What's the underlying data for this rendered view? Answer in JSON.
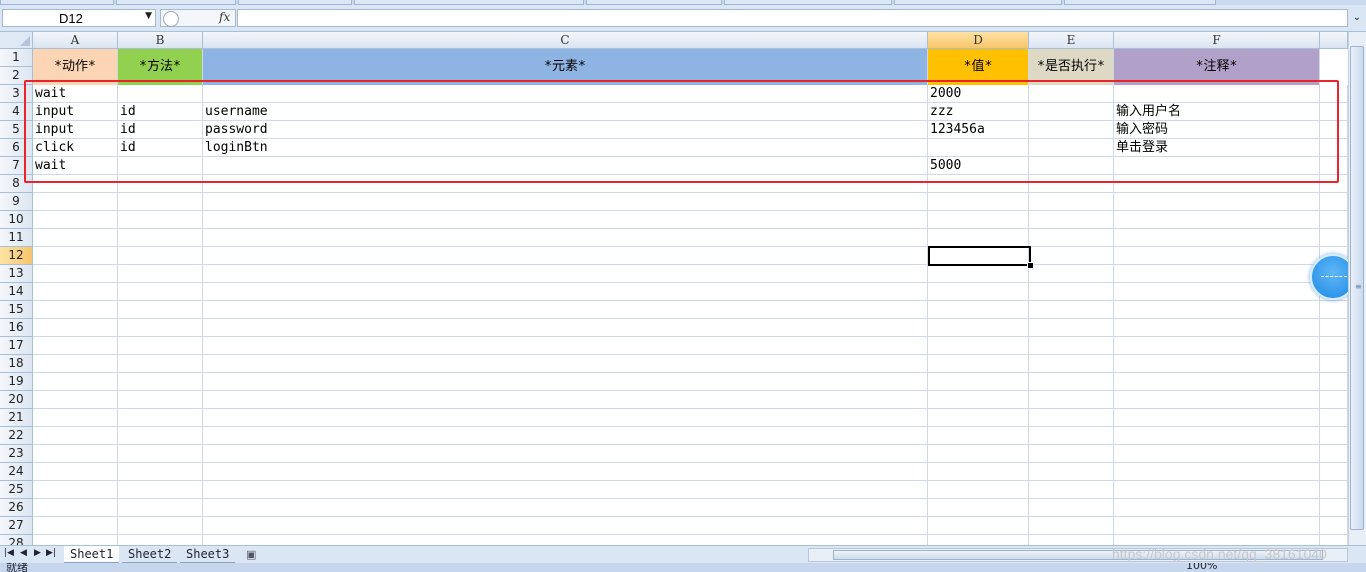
{
  "name_box": {
    "value": "D12"
  },
  "formula_bar": {
    "fx_label": "fx",
    "content": ""
  },
  "columns": [
    "A",
    "B",
    "C",
    "D",
    "E",
    "F"
  ],
  "active_column": "D",
  "rows": [
    "1",
    "2",
    "3",
    "4",
    "5",
    "6",
    "7",
    "8",
    "9",
    "10",
    "11",
    "12",
    "13",
    "14",
    "15",
    "16",
    "17",
    "18",
    "19",
    "20",
    "21",
    "22",
    "23",
    "24",
    "25",
    "26",
    "27",
    "28"
  ],
  "active_row": "12",
  "header_row": [
    "*动作*",
    "*方法*",
    "*元素*",
    "*值*",
    "*是否执行*",
    "*注释*"
  ],
  "header_colors": [
    "#fcd5b4",
    "#92d050",
    "#8db4e2",
    "#ffc000",
    "#ddd9c4",
    "#b1a0c7"
  ],
  "data_rows": [
    [
      "wait",
      "",
      "",
      "2000",
      "",
      ""
    ],
    [
      "input",
      "id",
      "username",
      "zzz",
      "",
      "输入用户名"
    ],
    [
      "input",
      "id",
      "password",
      "123456a",
      "",
      "输入密码"
    ],
    [
      "click",
      "id",
      "loginBtn",
      "",
      "",
      "单击登录"
    ],
    [
      "wait",
      "",
      "",
      "5000",
      "",
      ""
    ]
  ],
  "sheet_tabs": [
    "Sheet1",
    "Sheet2",
    "Sheet3"
  ],
  "active_sheet": "Sheet1",
  "watermark": "https://blog.csdn.net/qq_38161040",
  "status": {
    "ready": "就绪",
    "zoom": "100%"
  },
  "annotation_color": "#e8252a"
}
